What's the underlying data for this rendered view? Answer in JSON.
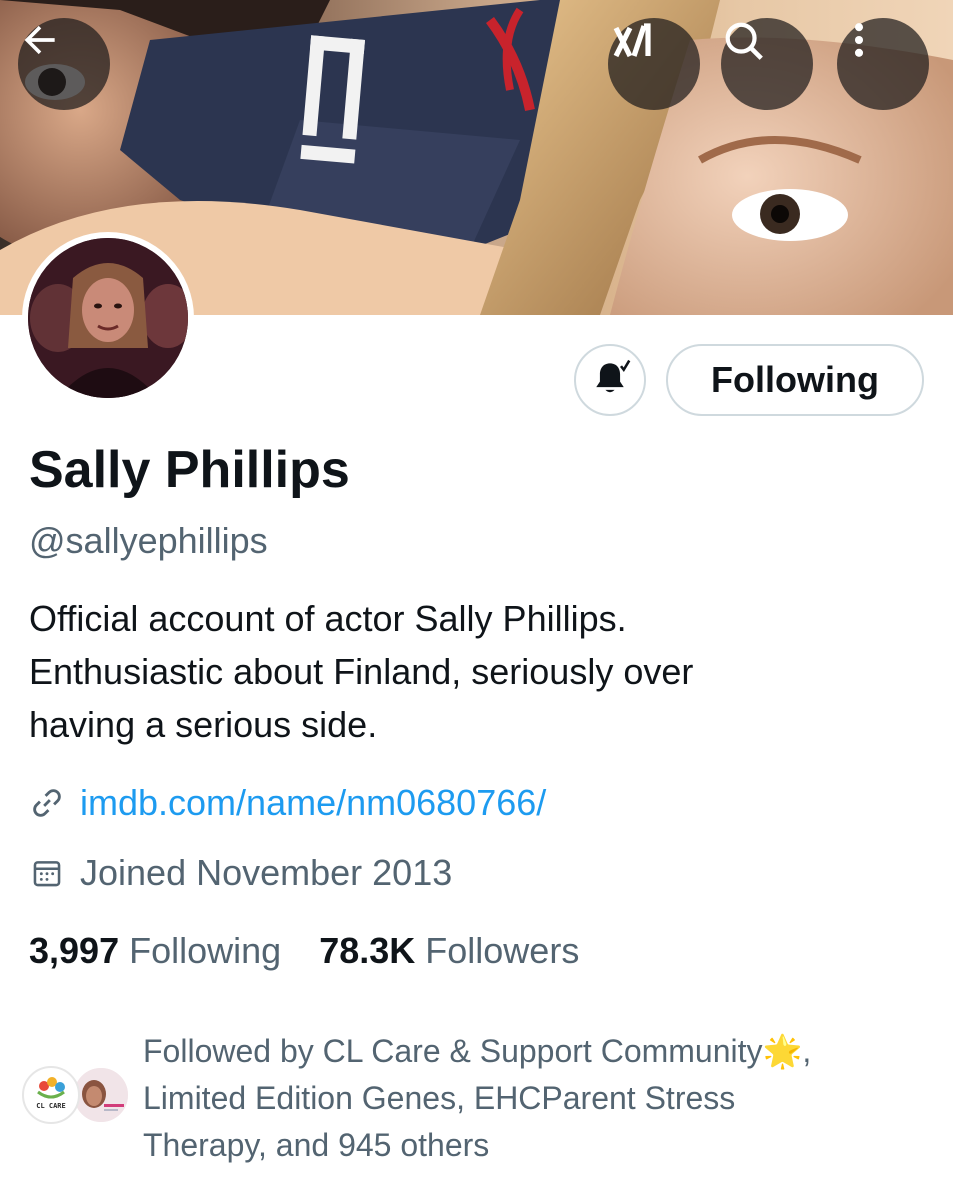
{
  "header": {
    "back_icon": "arrow-left-icon",
    "grok_icon": "grok-icon",
    "search_icon": "search-icon",
    "more_icon": "more-vertical-icon"
  },
  "profile": {
    "name": "Sally Phillips",
    "handle": "@sallyephillips",
    "bio_lines": [
      "Official account of actor Sally Phillips.",
      "Enthusiastic about Finland, seriously over",
      "having a serious side."
    ],
    "link": "imdb.com/name/nm0680766/",
    "joined": "Joined November 2013",
    "following_count": "3,997",
    "following_label": "Following",
    "followers_count": "78.3K",
    "followers_label": "Followers"
  },
  "actions": {
    "notifications_icon": "bell-check-icon",
    "follow_button_label": "Following"
  },
  "followed_by": {
    "lines": [
      "Followed by CL Care & Support Community🌟,",
      "Limited Edition Genes, EHCParent Stress",
      "Therapy, and 945 others"
    ],
    "avatar_1_label": "CL CARE"
  },
  "colors": {
    "text_primary": "#0f1419",
    "text_secondary": "#536471",
    "link": "#1d9bf0",
    "border": "#cfd9de"
  }
}
